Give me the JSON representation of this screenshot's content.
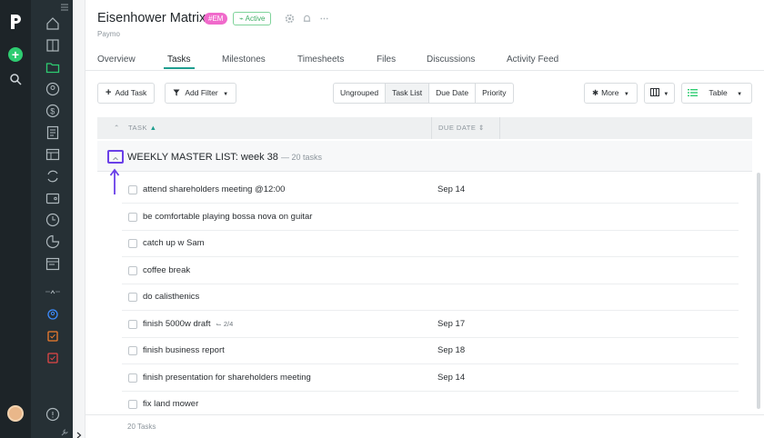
{
  "project": {
    "title": "Eisenhower Matrix",
    "code_badge": "#EM",
    "status_badge": "Active",
    "subtitle": "Paymo"
  },
  "tabs": [
    {
      "label": "Overview"
    },
    {
      "label": "Tasks",
      "active": true
    },
    {
      "label": "Milestones"
    },
    {
      "label": "Timesheets"
    },
    {
      "label": "Files"
    },
    {
      "label": "Discussions"
    },
    {
      "label": "Activity Feed"
    }
  ],
  "toolbar": {
    "add_task": "Add Task",
    "add_filter": "Add Filter",
    "grouping": [
      "Ungrouped",
      "Task List",
      "Due Date",
      "Priority"
    ],
    "grouping_selected": "Task List",
    "more": "More",
    "view": "Table"
  },
  "table": {
    "col_task": "TASK",
    "col_due": "DUE DATE"
  },
  "group": {
    "title": "WEEKLY MASTER LIST: week 38",
    "count": "— 20 tasks"
  },
  "tasks": [
    {
      "name": "attend shareholders meeting @12:00",
      "due": "Sep 14"
    },
    {
      "name": "be comfortable playing bossa nova on guitar",
      "due": ""
    },
    {
      "name": "catch up w Sam",
      "due": ""
    },
    {
      "name": "coffee break",
      "due": ""
    },
    {
      "name": "do calisthenics",
      "due": ""
    },
    {
      "name": "finish 5000w draft",
      "subtasks": "2/4",
      "due": "Sep 17"
    },
    {
      "name": "finish business report",
      "due": "Sep 18"
    },
    {
      "name": "finish presentation for shareholders meeting",
      "due": "Sep 14"
    },
    {
      "name": "fix land mower",
      "due": ""
    }
  ],
  "footer": {
    "count": "20 Tasks"
  },
  "colors": {
    "accent": "#1e9e8f",
    "badge_pink": "#f06acb",
    "active_green": "#3fae65",
    "highlight_purple": "#6a3fe8",
    "sidebar_dark": "#1d2428"
  }
}
